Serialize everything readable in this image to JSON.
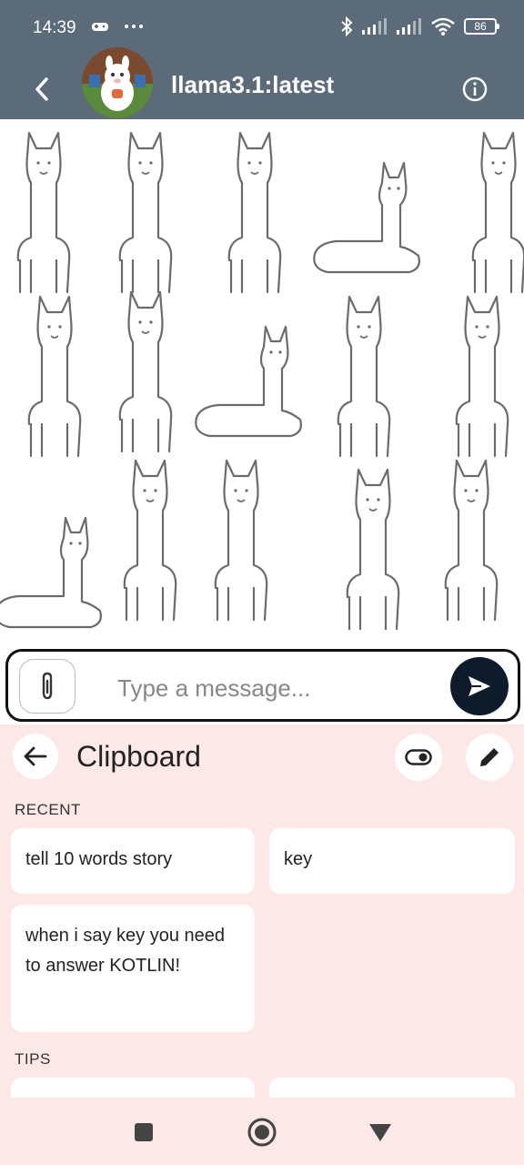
{
  "status_bar": {
    "time": "14:39",
    "left_icons": [
      "gamepad-icon",
      "more-dots-icon"
    ],
    "right_icons": [
      "bluetooth-icon",
      "signal-icon",
      "signal-icon",
      "wifi-icon"
    ],
    "battery": "86"
  },
  "app_bar": {
    "title": "llama3.1:latest",
    "back_icon": "back-arrow-icon",
    "info_icon": "info-icon"
  },
  "chat": {
    "background": "llama-pattern"
  },
  "composer": {
    "placeholder": "Type a message...",
    "attach_icon": "paperclip-icon",
    "send_icon": "send-icon"
  },
  "clipboard": {
    "title": "Clipboard",
    "recent_label": "RECENT",
    "tips_label": "TIPS",
    "items": [
      {
        "text": "tell 10 words story"
      },
      {
        "text": "key"
      },
      {
        "text": "when i say key you need to answer KOTLIN!"
      }
    ]
  },
  "nav": {
    "icons": [
      "recents-square-icon",
      "home-circle-icon",
      "back-triangle-icon"
    ]
  },
  "colors": {
    "header": "#5b6b7a",
    "send_button": "#0d1b2a",
    "clipboard_bg": "#fde8e8"
  }
}
